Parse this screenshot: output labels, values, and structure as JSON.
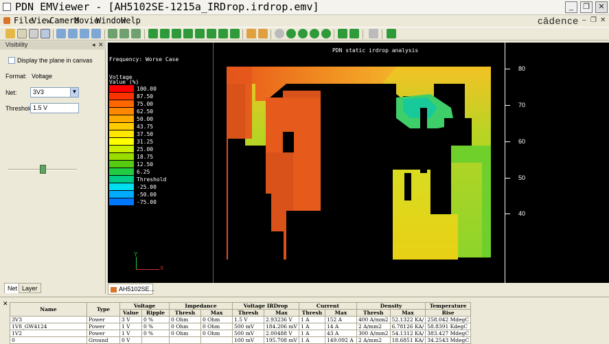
{
  "window": {
    "title": "PDN EMViewer - [AH5102SE-1215a_IRDrop.irdrop.emv]",
    "min": "_",
    "restore": "❐",
    "close": "✕"
  },
  "menu": {
    "items": [
      "File",
      "View",
      "Camera",
      "Movie",
      "Window",
      "Help"
    ],
    "brand": "cādence"
  },
  "panel": {
    "header": "Visibility",
    "display_plane_label": "Display the plane in canvas",
    "format_label": "Format:",
    "format_value": "Voltage",
    "net_label": "Net:",
    "net_value": "3V3",
    "threshold_label": "Threshold:",
    "threshold_value": "1.5 V",
    "slider_level": 0.5,
    "tabs": [
      "Net",
      "Layer"
    ]
  },
  "canvas": {
    "frequency": "Frequency: Worse Case",
    "plot_title": "PDN static irdrop analysis",
    "legend_title_1": "Voltage",
    "legend_title_2": "Value (%)",
    "legend": [
      {
        "label": "100.00",
        "color": "#ff0000"
      },
      {
        "label": "87.50",
        "color": "#ff3300"
      },
      {
        "label": "75.00",
        "color": "#ff6600"
      },
      {
        "label": "62.50",
        "color": "#ff8800"
      },
      {
        "label": "50.00",
        "color": "#ffaa00"
      },
      {
        "label": "43.75",
        "color": "#ffcc00"
      },
      {
        "label": "37.50",
        "color": "#ffe600"
      },
      {
        "label": "31.25",
        "color": "#ffff00"
      },
      {
        "label": "25.00",
        "color": "#ccee00"
      },
      {
        "label": "18.75",
        "color": "#99dd00"
      },
      {
        "label": "12.50",
        "color": "#55cc11"
      },
      {
        "label": "6.25",
        "color": "#22cc44"
      },
      {
        "label": "Threshold",
        "color": "#00cc88"
      },
      {
        "label": "-25.00",
        "color": "#00ddee"
      },
      {
        "label": "-50.00",
        "color": "#00aaff"
      },
      {
        "label": "-75.00",
        "color": "#0077ff"
      }
    ],
    "y_ticks": [
      "80",
      "70",
      "60",
      "50",
      "40"
    ],
    "axis_x": "X",
    "axis_y": "Y"
  },
  "doc_tab": "AH5102SE...",
  "table": {
    "groups": [
      "Name",
      "Type",
      "Voltage",
      "Impedance",
      "Voltage IRDrop",
      "Current",
      "Density",
      "Temperature"
    ],
    "subheaders": [
      "Value",
      "Ripple",
      "Thresh",
      "Max",
      "Thresh",
      "Max",
      "Thresh",
      "Max",
      "Thresh",
      "Max",
      "Rise"
    ],
    "rows": [
      [
        "3V3",
        "Power",
        "3 V",
        "0 %",
        "0 Ohm",
        "0 Ohm",
        "1.5 V",
        "2.93236 V",
        "1 A",
        "152 A",
        "400 A/mm2",
        "52.1322 KA/",
        "258.042 MdegC"
      ],
      [
        "1V8_GW4124",
        "Power",
        "1 V",
        "0 %",
        "0 Ohm",
        "0 Ohm",
        "500 mV",
        "184.206 mV",
        "1 A",
        "14 A",
        "2 A/mm2",
        "6.78126 KA/",
        "58.8391 KdegC"
      ],
      [
        "1V2",
        "Power",
        "1 V",
        "0 %",
        "0 Ohm",
        "0 Ohm",
        "500 mV",
        "2.00488 V",
        "1 A",
        "43 A",
        "300 A/mm2",
        "54.1312 KA/",
        "383.427 MdegC"
      ],
      [
        "0",
        "Ground",
        "0 V",
        "",
        "",
        "",
        "100 mV",
        "195.708 mV",
        "1 A",
        "149.092 A",
        "2 A/mm2",
        "18.6851 KA/",
        "34.2543 MdegC"
      ]
    ]
  }
}
